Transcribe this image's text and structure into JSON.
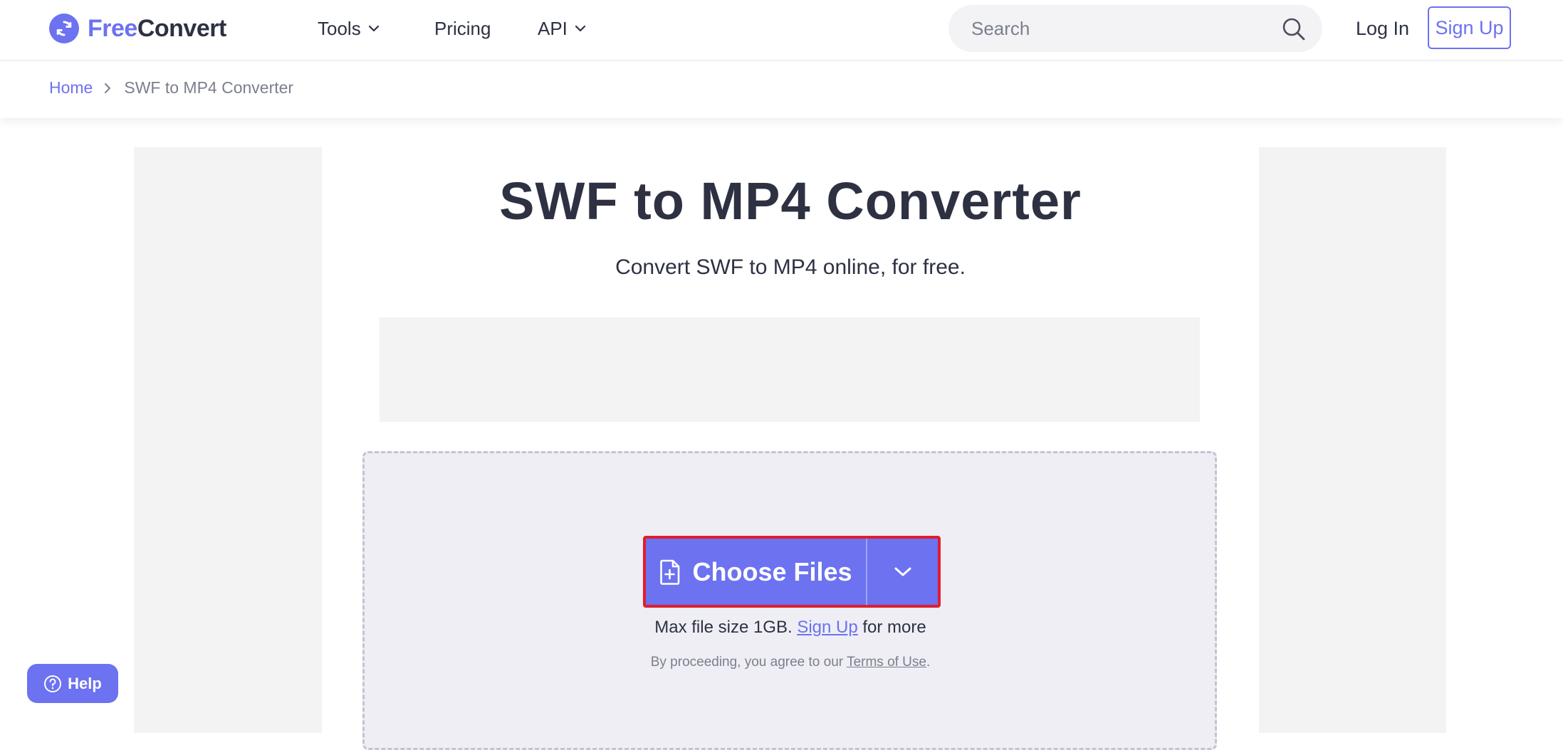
{
  "header": {
    "logo_free": "Free",
    "logo_convert": "Convert",
    "nav": [
      {
        "label": "Tools",
        "icon": "chevron-down-icon"
      },
      {
        "label": "Pricing"
      },
      {
        "label": "API",
        "icon": "chevron-down-icon"
      }
    ],
    "search_placeholder": "Search",
    "login": "Log In",
    "signup": "Sign Up"
  },
  "breadcrumb": {
    "home": "Home",
    "current": "SWF to MP4 Converter"
  },
  "main": {
    "title": "SWF to MP4 Converter",
    "subtitle": "Convert SWF to MP4 online, for free.",
    "choose_files": "Choose Files",
    "max_size_prefix": "Max file size 1GB. ",
    "max_size_link": "Sign Up",
    "max_size_suffix": " for more",
    "terms_prefix": "By proceeding, you agree to our ",
    "terms_link": "Terms of Use",
    "terms_suffix": "."
  },
  "help": {
    "label": "Help"
  },
  "colors": {
    "accent": "#6c72f0",
    "text": "#2d3142",
    "muted": "#7b7f8e",
    "highlight_border": "#e11d2e",
    "dropzone_bg": "#eeeef4"
  }
}
